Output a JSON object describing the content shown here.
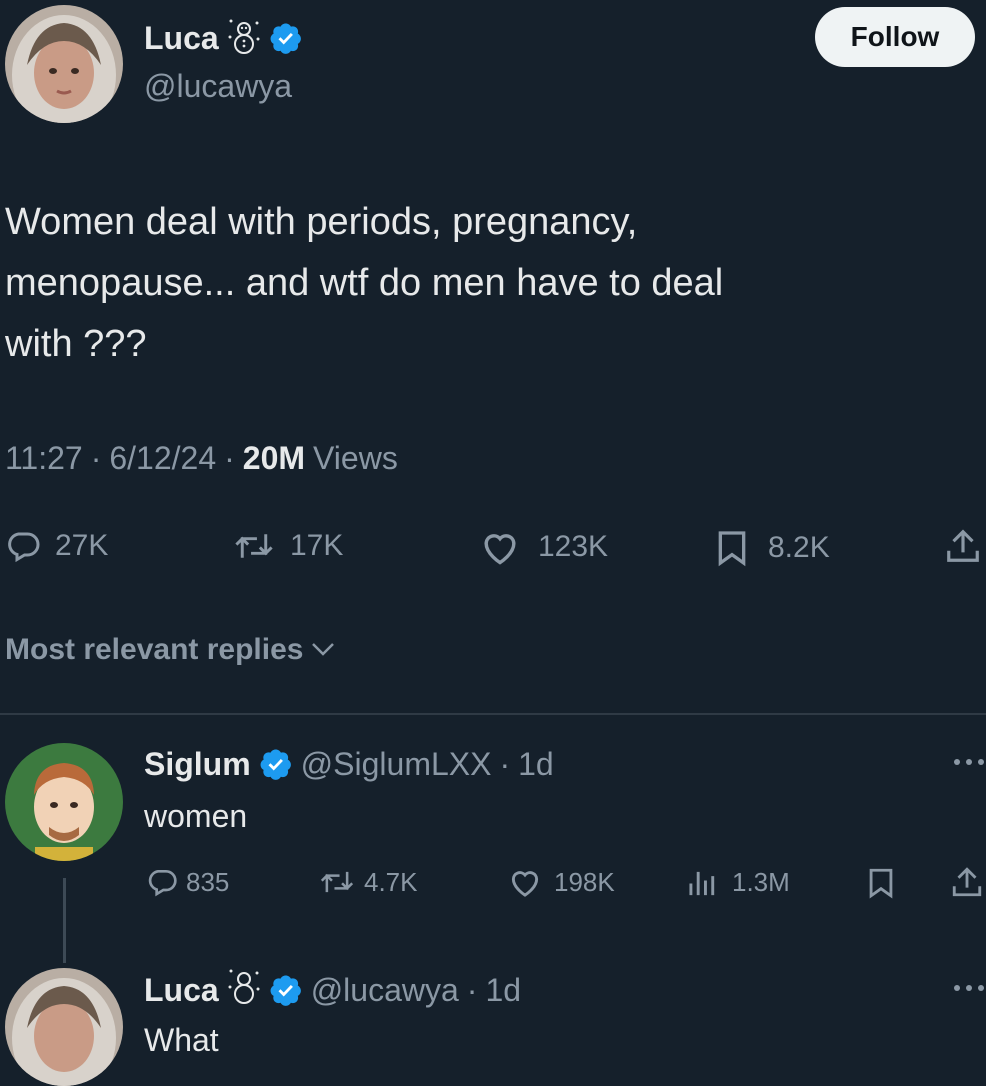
{
  "main_tweet": {
    "author": {
      "name": "Luca",
      "handle": "@lucawya"
    },
    "follow_label": "Follow",
    "text_lines": [
      "Women deal with periods, pregnancy,",
      "menopause... and wtf do men have to deal",
      "with ???"
    ],
    "meta": {
      "time": "11:27",
      "date": "6/12/24",
      "views_count": "20M",
      "views_label": "Views",
      "sep": "·"
    },
    "actions": {
      "replies": "27K",
      "retweets": "17K",
      "likes": "123K",
      "bookmarks": "8.2K"
    }
  },
  "replies_sort": {
    "label": "Most relevant replies"
  },
  "reply": {
    "author": {
      "name": "Siglum",
      "handle": "@SiglumLXX",
      "age": "1d"
    },
    "text": "women",
    "actions": {
      "replies": "835",
      "retweets": "4.7K",
      "likes": "198K",
      "views": "1.3M"
    }
  },
  "reply2": {
    "author": {
      "name": "Luca",
      "handle": "@lucawya",
      "age": "1d"
    },
    "text": "What"
  },
  "colors": {
    "background": "#15202b",
    "verified": "#1d9bf0",
    "muted": "#8b98a5",
    "text": "#e7e9ea"
  },
  "icons": [
    "verified-badge-icon",
    "snowman-icon",
    "reply-icon",
    "retweet-icon",
    "like-icon",
    "bookmark-icon",
    "share-icon",
    "views-icon",
    "chevron-down-icon",
    "more-icon"
  ]
}
